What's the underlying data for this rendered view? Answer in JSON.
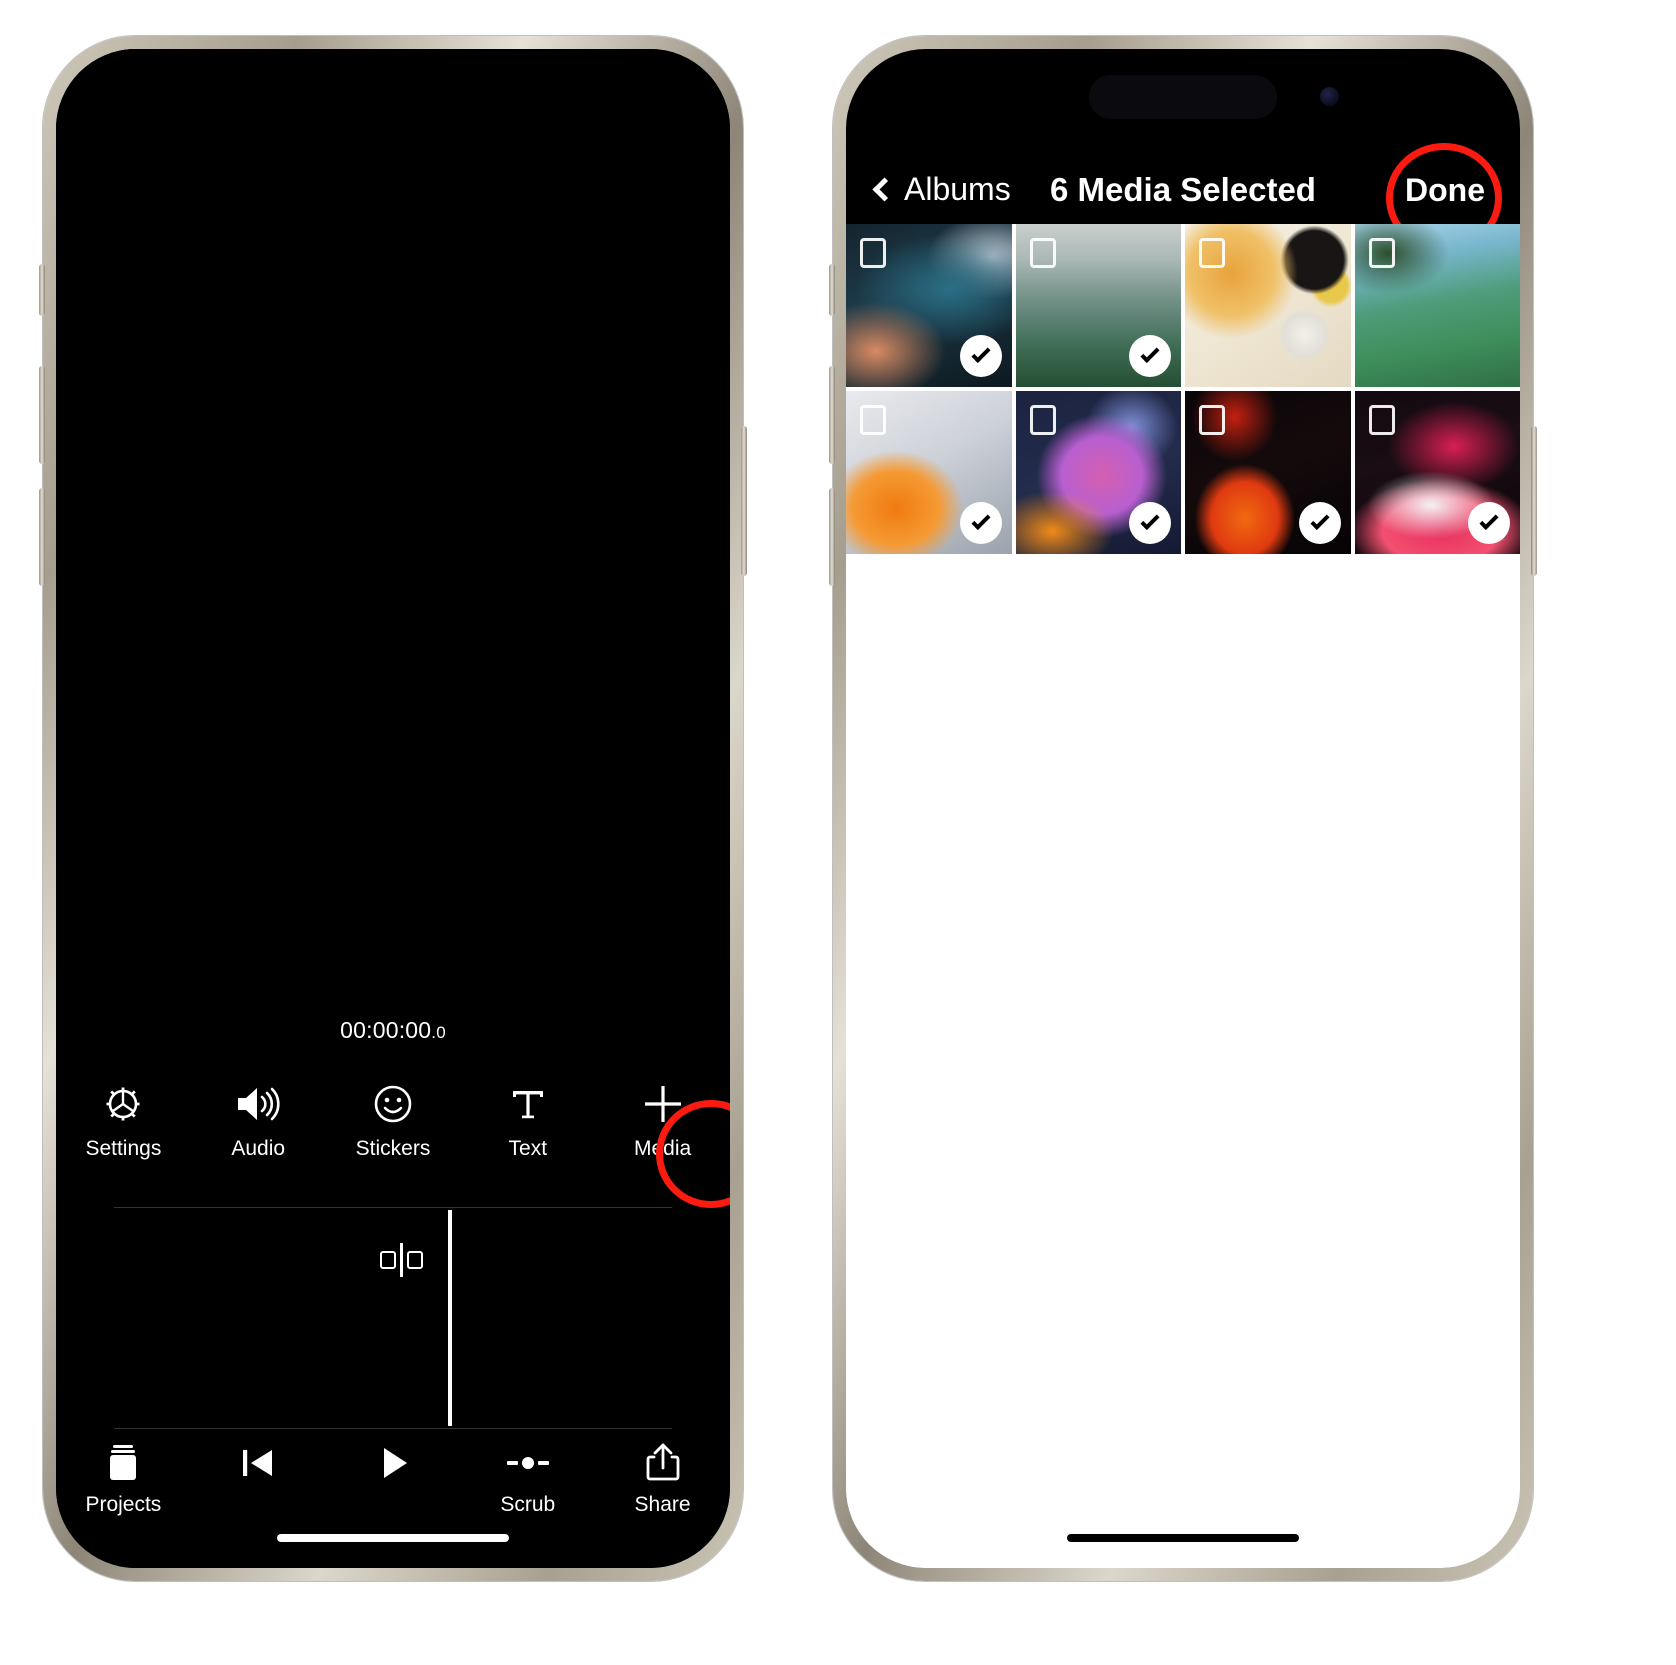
{
  "editor": {
    "timecode": "00:00:00",
    "timecode_fraction": ".0",
    "tools": [
      {
        "label": "Settings",
        "icon": "gear-icon"
      },
      {
        "label": "Audio",
        "icon": "speaker-icon"
      },
      {
        "label": "Stickers",
        "icon": "smiley-icon"
      },
      {
        "label": "Text",
        "icon": "text-t-icon"
      },
      {
        "label": "Media",
        "icon": "plus-icon"
      }
    ],
    "nav": [
      {
        "label": "Projects",
        "icon": "projects-stack-icon"
      },
      {
        "label": "",
        "icon": "skip-to-start-icon"
      },
      {
        "label": "",
        "icon": "play-icon"
      },
      {
        "label": "Scrub",
        "icon": "scrub-icon"
      },
      {
        "label": "Share",
        "icon": "share-icon"
      }
    ],
    "highlight_color": "#fb1b10",
    "highlighted_tool": "Media"
  },
  "picker": {
    "back_label": "Albums",
    "title": "6 Media Selected",
    "done_label": "Done",
    "highlight_color": "#fb1b10",
    "highlighted_control": "Done",
    "selected_count": 6,
    "items": [
      {
        "name": "abstract-teal-wave",
        "art": "art1",
        "selected": true
      },
      {
        "name": "misty-green-hills",
        "art": "art2",
        "selected": true
      },
      {
        "name": "breakfast-pancakes",
        "art": "art3",
        "selected": false
      },
      {
        "name": "aerial-green-forest",
        "art": "art4",
        "selected": false
      },
      {
        "name": "orange-silver-swirl",
        "art": "art5",
        "selected": true
      },
      {
        "name": "purple-orange-fabric",
        "art": "art6",
        "selected": true
      },
      {
        "name": "dark-flame-abstract",
        "art": "art7",
        "selected": true
      },
      {
        "name": "red-pink-ribbon",
        "art": "art8",
        "selected": true
      }
    ]
  }
}
